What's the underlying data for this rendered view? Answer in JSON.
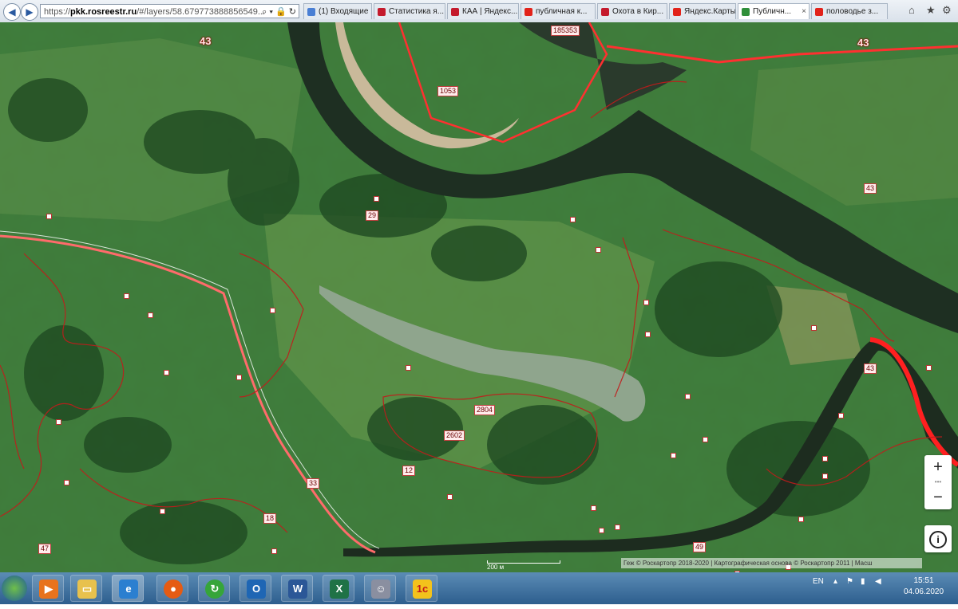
{
  "browser": {
    "url_prefix": "https://",
    "url_domain": "pkk.rosreestr.ru",
    "url_rest": "/#/layers/58.679773888856549...",
    "tabs": [
      {
        "title": "(1) Входящие",
        "color": "#4a7fd4"
      },
      {
        "title": "Статистика я...",
        "color": "#c41a2c"
      },
      {
        "title": "КАА | Яндекс...",
        "color": "#c41a2c"
      },
      {
        "title": "публичная к...",
        "color": "#e2231a"
      },
      {
        "title": "Охота в Кир...",
        "color": "#c41a2c"
      },
      {
        "title": "Яндекс.Карты",
        "color": "#e2231a"
      },
      {
        "title": "Публичн...",
        "color": "#2f8f3a",
        "active": true
      },
      {
        "title": "половодье з...",
        "color": "#e2231a"
      }
    ]
  },
  "map": {
    "parcel_labels": [
      {
        "text": "43",
        "big": true
      },
      {
        "text": "185353"
      },
      {
        "text": "43",
        "big": true
      },
      {
        "text": "1053"
      },
      {
        "text": "43"
      },
      {
        "text": "43"
      },
      {
        "text": "12"
      },
      {
        "text": "2804"
      },
      {
        "text": "2602"
      },
      {
        "text": "33"
      },
      {
        "text": "18"
      },
      {
        "text": "47"
      },
      {
        "text": "49"
      },
      {
        "text": "29"
      }
    ],
    "scale_label": "200 м",
    "attribution": "Геж © Роскартопр 2018-2020 | Картографическая основа © Роскартопр 2011 | Масш"
  },
  "controls": {
    "zoom_in": "+",
    "zoom_dots": "•••",
    "zoom_out": "−",
    "info": "i"
  },
  "taskbar": {
    "lang": "EN",
    "time": "15:51",
    "date": "04.06.2020"
  }
}
